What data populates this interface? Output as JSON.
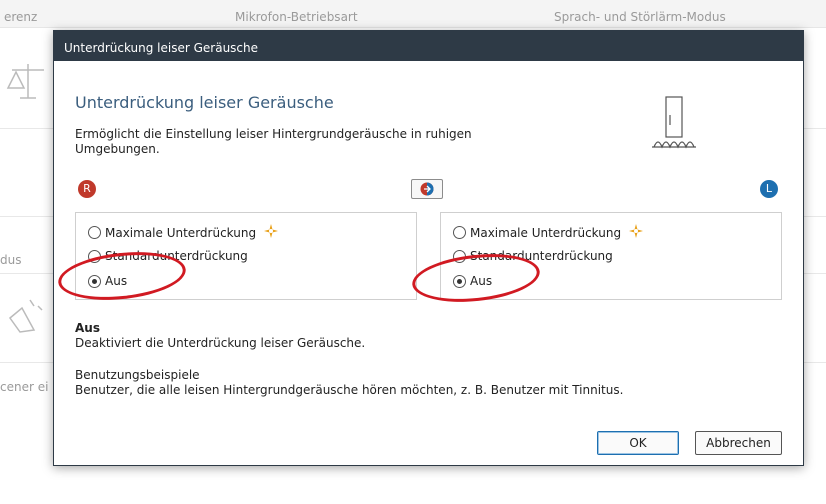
{
  "background": {
    "tabs": [
      "erenz",
      "Mikrofon-Betriebsart",
      "Sprach- und Störlärm-Modus"
    ],
    "side_labels": [
      "dus",
      "cener ei"
    ]
  },
  "dialog": {
    "title": "Unterdrückung leiser Geräusche",
    "heading": "Unterdrückung leiser Geräusche",
    "description": "Ermöglicht die Einstellung leiser Hintergrundgeräusche in ruhigen Umgebungen.",
    "ear_right": "R",
    "ear_left": "L",
    "right_options": [
      {
        "label": "Maximale Unterdrückung",
        "checked": false
      },
      {
        "label": "Standardunterdrückung",
        "checked": false
      },
      {
        "label": "Aus",
        "checked": true
      }
    ],
    "left_options": [
      {
        "label": "Maximale Unterdrückung",
        "checked": false
      },
      {
        "label": "Standardunterdrückung",
        "checked": false
      },
      {
        "label": "Aus",
        "checked": true
      }
    ],
    "info_title": "Aus",
    "info_text": "Deaktiviert die Unterdrückung leiser Geräusche.",
    "example_title": "Benutzungsbeispiele",
    "example_text": "Benutzer, die alle leisen Hintergrundgeräusche hören möchten, z. B. Benutzer mit Tinnitus.",
    "ok_label": "OK",
    "cancel_label": "Abbrechen"
  },
  "colors": {
    "titlebar": "#2e3a46",
    "heading": "#3b5e7e",
    "right_ear": "#c0392b",
    "left_ear": "#1d6fb0",
    "annotation": "#d11a22"
  },
  "icons": [
    "balance-scale-icon",
    "speaker-icon",
    "sparkle-icon",
    "link-ears-icon",
    "noise-illustration-icon"
  ]
}
